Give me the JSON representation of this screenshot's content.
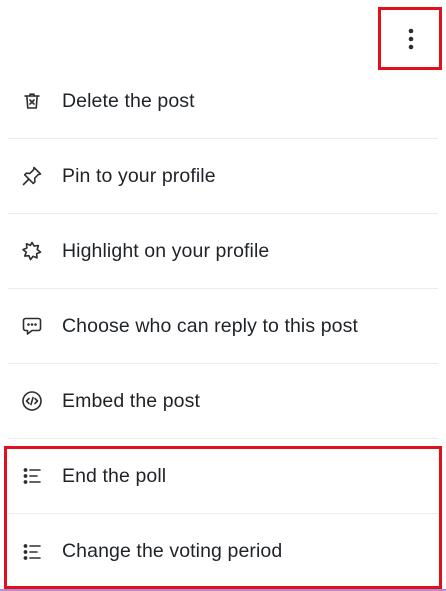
{
  "header": {
    "more_button_icon": "vertical-ellipsis-icon"
  },
  "menu": {
    "items": [
      {
        "label": "Delete the post",
        "icon": "trash-icon"
      },
      {
        "label": "Pin to your profile",
        "icon": "pin-icon"
      },
      {
        "label": "Highlight on your profile",
        "icon": "highlight-burst-icon"
      },
      {
        "label": "Choose who can reply to this post",
        "icon": "chat-bubble-icon"
      },
      {
        "label": "Embed the post",
        "icon": "code-embed-icon"
      },
      {
        "label": "End the poll",
        "icon": "poll-list-icon"
      },
      {
        "label": "Change the voting period",
        "icon": "poll-list-icon"
      }
    ]
  },
  "colors": {
    "highlight_border": "#e0101d",
    "text": "#1f2328",
    "divider": "#ebebeb"
  }
}
